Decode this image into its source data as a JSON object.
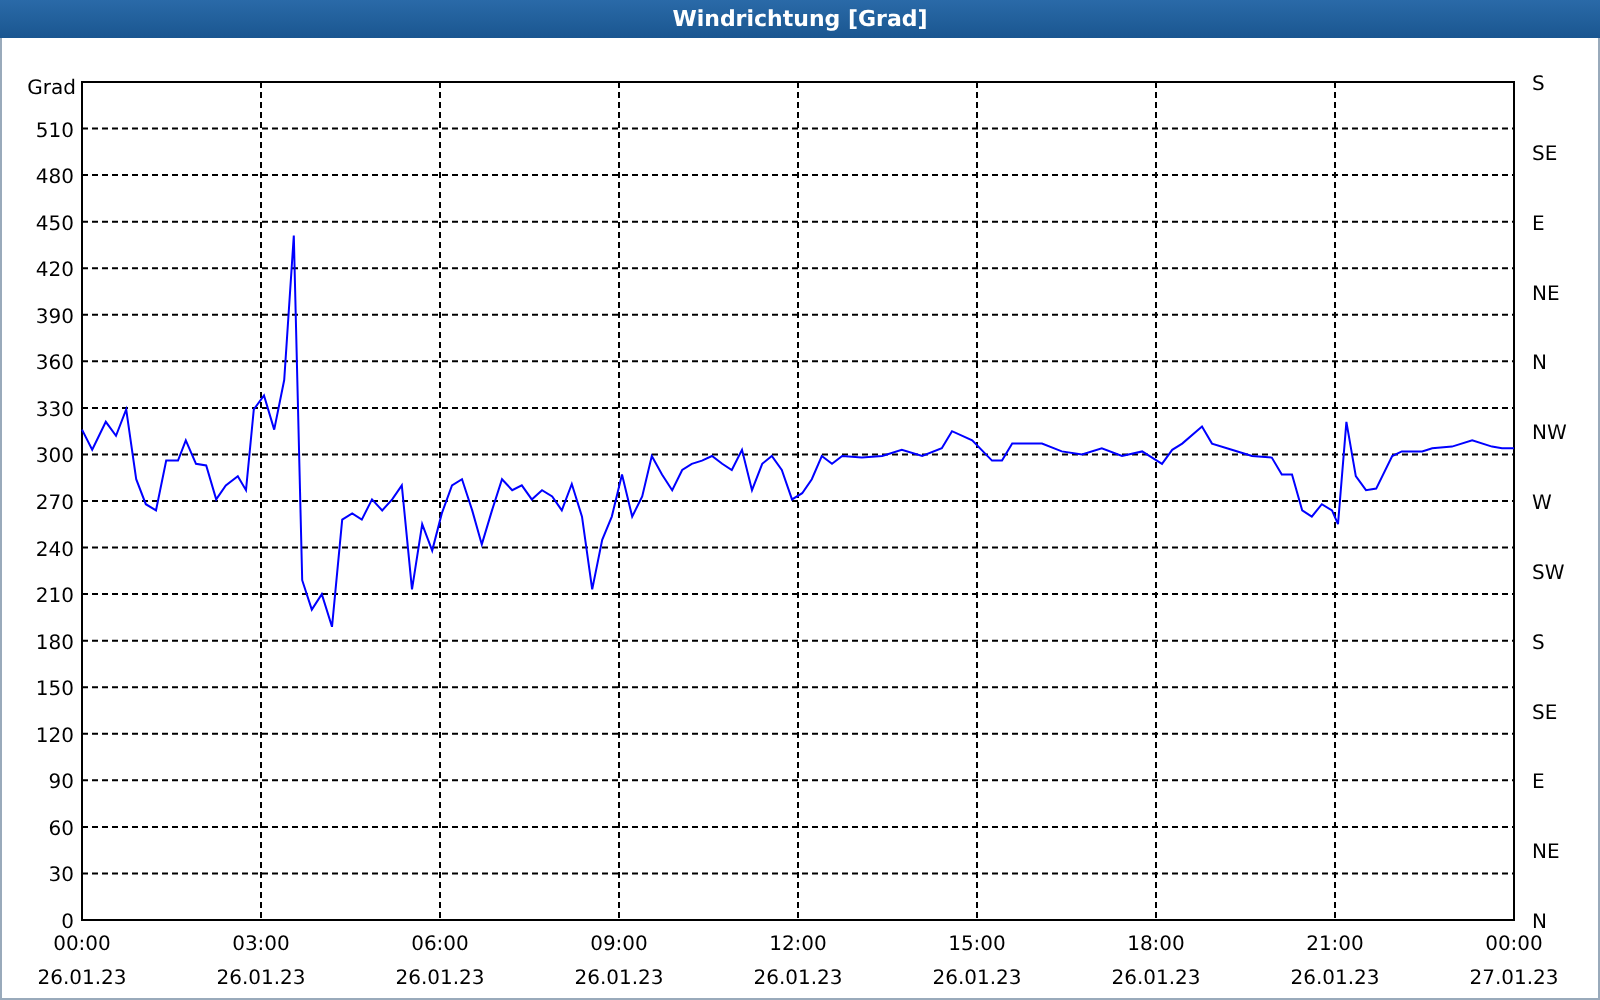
{
  "window": {
    "title": "Windrichtung [Grad]"
  },
  "chart": {
    "right_axis_labels": [
      "S",
      "SE",
      "E",
      "NE",
      "N",
      "NW",
      "W",
      "SW",
      "S",
      "SE",
      "E",
      "NE",
      "N"
    ],
    "date_labels": [
      "26.01.23",
      "26.01.23",
      "26.01.23",
      "26.01.23",
      "26.01.23",
      "26.01.23",
      "26.01.23",
      "26.01.23",
      "27.01.23"
    ],
    "chart_data": {
      "type": "line",
      "grid": true,
      "ylabel": "Grad",
      "xlim": [
        0,
        24
      ],
      "ylim": [
        0,
        540
      ],
      "xticks": [
        {
          "value": 0,
          "label": "00:00"
        },
        {
          "value": 3,
          "label": "03:00"
        },
        {
          "value": 6,
          "label": "06:00"
        },
        {
          "value": 9,
          "label": "09:00"
        },
        {
          "value": 12,
          "label": "12:00"
        },
        {
          "value": 15,
          "label": "15:00"
        },
        {
          "value": 18,
          "label": "18:00"
        },
        {
          "value": 21,
          "label": "21:00"
        },
        {
          "value": 24,
          "label": "00:00"
        }
      ],
      "yticks": [
        0,
        30,
        60,
        90,
        120,
        150,
        180,
        210,
        240,
        270,
        300,
        330,
        360,
        390,
        420,
        450,
        480,
        510
      ],
      "x": [
        0,
        0.17,
        0.4,
        0.57,
        0.74,
        0.91,
        1.07,
        1.24,
        1.41,
        1.61,
        1.74,
        1.91,
        2.08,
        2.25,
        2.41,
        2.61,
        2.75,
        2.88,
        3.05,
        3.22,
        3.39,
        3.55,
        3.69,
        3.85,
        4.02,
        4.19,
        4.36,
        4.53,
        4.69,
        4.86,
        5.03,
        5.2,
        5.36,
        5.53,
        5.7,
        5.87,
        6.03,
        6.2,
        6.37,
        6.54,
        6.7,
        6.87,
        7.04,
        7.21,
        7.37,
        7.54,
        7.71,
        7.88,
        8.04,
        8.21,
        8.38,
        8.55,
        8.72,
        8.88,
        9.05,
        9.22,
        9.39,
        9.55,
        9.72,
        9.89,
        10.06,
        10.22,
        10.39,
        10.56,
        10.73,
        10.89,
        11.06,
        11.23,
        11.4,
        11.56,
        11.73,
        11.9,
        12.07,
        12.23,
        12.4,
        12.57,
        12.74,
        13.07,
        13.41,
        13.74,
        14.08,
        14.41,
        14.58,
        14.92,
        15.25,
        15.42,
        15.59,
        16.09,
        16.42,
        16.76,
        17.09,
        17.43,
        17.77,
        18.1,
        18.27,
        18.44,
        18.77,
        18.94,
        19.27,
        19.61,
        19.94,
        20.11,
        20.28,
        20.45,
        20.61,
        20.78,
        20.95,
        21.05,
        21.19,
        21.35,
        21.52,
        21.69,
        21.96,
        22.12,
        22.46,
        22.63,
        22.96,
        23.3,
        23.63,
        23.8,
        24
      ],
      "series": [
        {
          "color": "#0000ff",
          "values": [
            316,
            303,
            321,
            312,
            329,
            284,
            268,
            264,
            296,
            296,
            309,
            294,
            293,
            271,
            280,
            286,
            277,
            329,
            338,
            316,
            348,
            441,
            219,
            200,
            210,
            189,
            258,
            262,
            258,
            271,
            264,
            271,
            280,
            213,
            255,
            238,
            262,
            280,
            284,
            264,
            242,
            264,
            284,
            277,
            280,
            271,
            277,
            273,
            264,
            281,
            260,
            213,
            245,
            260,
            287,
            260,
            273,
            299,
            287,
            277,
            290,
            294,
            296,
            299,
            294,
            290,
            303,
            277,
            294,
            299,
            290,
            271,
            275,
            284,
            299,
            294,
            299,
            298,
            299,
            303,
            299,
            304,
            315,
            309,
            296,
            296,
            307,
            307,
            302,
            300,
            304,
            299,
            302,
            294,
            303,
            307,
            318,
            307,
            303,
            299,
            298,
            287,
            287,
            264,
            260,
            268,
            264,
            255,
            321,
            286,
            277,
            278,
            299,
            302,
            302,
            304,
            305,
            309,
            305,
            304,
            304
          ]
        }
      ]
    }
  }
}
